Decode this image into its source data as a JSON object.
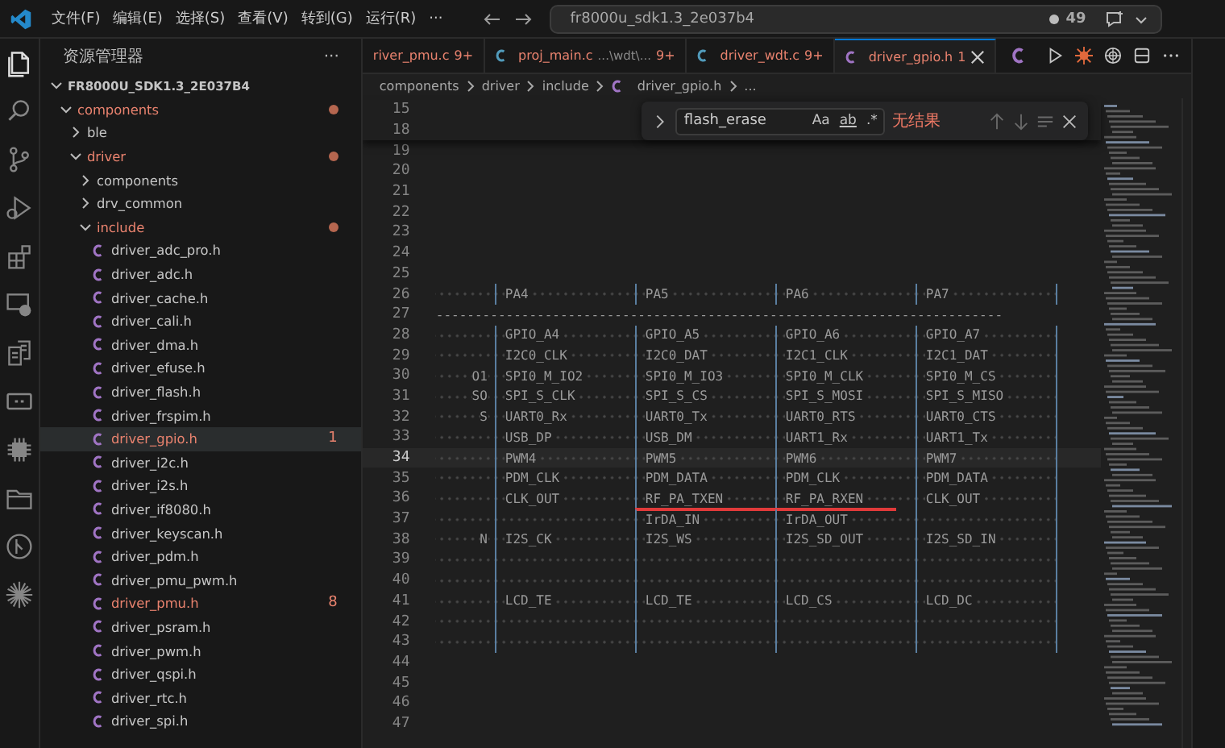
{
  "title_bar": {
    "menu": [
      "文件(F)",
      "编辑(E)",
      "选择(S)",
      "查看(V)",
      "转到(G)",
      "运行(R)",
      "···"
    ],
    "search": {
      "value": "fr8000u_sdk1.3_2e037b4"
    },
    "count": "49"
  },
  "activity_bar": [
    {
      "kind": "files",
      "selected": true
    },
    {
      "kind": "search",
      "selected": false
    },
    {
      "kind": "source-control",
      "selected": false
    },
    {
      "kind": "run",
      "selected": false
    },
    {
      "kind": "extensions",
      "selected": false
    },
    {
      "kind": "remote",
      "selected": false
    },
    {
      "kind": "clipboard",
      "selected": false
    },
    {
      "kind": "panel",
      "selected": false
    },
    {
      "kind": "chip",
      "selected": false
    },
    {
      "kind": "folder",
      "selected": false
    },
    {
      "kind": "branch",
      "selected": false
    },
    {
      "kind": "sparkle",
      "selected": false
    }
  ],
  "sidebar": {
    "title": "资源管理器",
    "more": "···",
    "tree": [
      {
        "label": "FR8000U_SDK1.3_2E037B4",
        "kind": "root",
        "expanded": true,
        "problems": false,
        "selected": false,
        "children": [
          {
            "label": "components",
            "kind": "folder",
            "expanded": true,
            "problems": true,
            "selected": false,
            "children": [
              {
                "label": "ble",
                "kind": "folder",
                "expanded": false,
                "problems": false,
                "selected": false
              },
              {
                "label": "driver",
                "kind": "folder",
                "expanded": true,
                "problems": true,
                "selected": false,
                "children": [
                  {
                    "label": "components",
                    "kind": "folder",
                    "expanded": false,
                    "problems": false,
                    "selected": false
                  },
                  {
                    "label": "drv_common",
                    "kind": "folder",
                    "expanded": false,
                    "problems": false,
                    "selected": false
                  },
                  {
                    "label": "include",
                    "kind": "folder",
                    "expanded": true,
                    "problems": true,
                    "selected": false,
                    "children": [
                      {
                        "label": "driver_adc_pro.h",
                        "kind": "file",
                        "problems": false,
                        "selected": false
                      },
                      {
                        "label": "driver_adc.h",
                        "kind": "file",
                        "problems": false,
                        "selected": false
                      },
                      {
                        "label": "driver_cache.h",
                        "kind": "file",
                        "problems": false,
                        "selected": false
                      },
                      {
                        "label": "driver_cali.h",
                        "kind": "file",
                        "problems": false,
                        "selected": false
                      },
                      {
                        "label": "driver_dma.h",
                        "kind": "file",
                        "problems": false,
                        "selected": false
                      },
                      {
                        "label": "driver_efuse.h",
                        "kind": "file",
                        "problems": false,
                        "selected": false
                      },
                      {
                        "label": "driver_flash.h",
                        "kind": "file",
                        "problems": false,
                        "selected": false
                      },
                      {
                        "label": "driver_frspim.h",
                        "kind": "file",
                        "problems": false,
                        "selected": false
                      },
                      {
                        "label": "driver_gpio.h",
                        "kind": "file",
                        "problems": true,
                        "badge": "1",
                        "selected": true
                      },
                      {
                        "label": "driver_i2c.h",
                        "kind": "file",
                        "problems": false,
                        "selected": false
                      },
                      {
                        "label": "driver_i2s.h",
                        "kind": "file",
                        "problems": false,
                        "selected": false
                      },
                      {
                        "label": "driver_if8080.h",
                        "kind": "file",
                        "problems": false,
                        "selected": false
                      },
                      {
                        "label": "driver_keyscan.h",
                        "kind": "file",
                        "problems": false,
                        "selected": false
                      },
                      {
                        "label": "driver_pdm.h",
                        "kind": "file",
                        "problems": false,
                        "selected": false
                      },
                      {
                        "label": "driver_pmu_pwm.h",
                        "kind": "file",
                        "problems": false,
                        "selected": false
                      },
                      {
                        "label": "driver_pmu.h",
                        "kind": "file",
                        "problems": true,
                        "badge": "8",
                        "selected": false
                      },
                      {
                        "label": "driver_psram.h",
                        "kind": "file",
                        "problems": false,
                        "selected": false
                      },
                      {
                        "label": "driver_pwm.h",
                        "kind": "file",
                        "problems": false,
                        "selected": false
                      },
                      {
                        "label": "driver_qspi.h",
                        "kind": "file",
                        "problems": false,
                        "selected": false
                      },
                      {
                        "label": "driver_rtc.h",
                        "kind": "file",
                        "problems": false,
                        "selected": false
                      },
                      {
                        "label": "driver_spi.h",
                        "kind": "file",
                        "problems": false,
                        "selected": false
                      }
                    ]
                  }
                ]
              }
            ]
          }
        ]
      }
    ]
  },
  "tabs": [
    {
      "label": "river_pmu.c",
      "badge": "9+",
      "problems": true,
      "selected": false
    },
    {
      "label": "proj_main.c",
      "color": "#519aba",
      "description": "...\\wdt\\...",
      "badge": "9+",
      "problems": true,
      "selected": false
    },
    {
      "label": "driver_wdt.c",
      "color": "#519aba",
      "badge": "9+",
      "problems": true,
      "selected": false
    },
    {
      "label": "driver_gpio.h",
      "color": "#a074c4",
      "badge": "1",
      "problems": true,
      "selected": true
    }
  ],
  "breadcrumb": [
    "components",
    "driver",
    "include",
    "driver_gpio.h",
    "..."
  ],
  "find": {
    "query": "flash_erase",
    "options": [
      "Aa",
      "ab",
      ".*"
    ],
    "result": "无结果"
  },
  "sticky_lines": [
    "15",
    "18"
  ],
  "lines": [
    {
      "number": "19",
      "kind": "blank",
      "current": false
    },
    {
      "number": "20",
      "kind": "blank",
      "current": false
    },
    {
      "number": "21",
      "kind": "blank",
      "current": false
    },
    {
      "number": "22",
      "kind": "blank",
      "current": false
    },
    {
      "number": "23",
      "kind": "blank",
      "current": false
    },
    {
      "number": "24",
      "kind": "blank",
      "current": false
    },
    {
      "number": "25",
      "kind": "blank",
      "current": false
    },
    {
      "number": "26",
      "kind": "row",
      "current": false,
      "cells": [
        "PA4",
        "PA5",
        "PA6",
        "PA7"
      ]
    },
    {
      "number": "27",
      "kind": "rule",
      "current": false,
      "text": "-------------------------------------------------------------------------"
    },
    {
      "number": "28",
      "kind": "row",
      "current": false,
      "cells": [
        "GPIO_A4",
        "GPIO_A5",
        "GPIO_A6",
        "GPIO_A7"
      ]
    },
    {
      "number": "29",
      "kind": "row",
      "current": false,
      "cells": [
        "I2C0_CLK",
        "I2C0_DAT",
        "I2C1_CLK",
        "I2C1_DAT"
      ]
    },
    {
      "number": "30",
      "kind": "row",
      "current": false,
      "lead": "O1",
      "cells": [
        "SPI0_M_IO2",
        "SPI0_M_IO3",
        "SPI0_M_CLK",
        "SPI0_M_CS"
      ]
    },
    {
      "number": "31",
      "kind": "row",
      "current": false,
      "lead": "SO",
      "cells": [
        "SPI_S_CLK",
        "SPI_S_CS",
        "SPI_S_MOSI",
        "SPI_S_MISO"
      ]
    },
    {
      "number": "32",
      "kind": "row",
      "current": false,
      "lead": "S",
      "cells": [
        "UART0_Rx",
        "UART0_Tx",
        "UART0_RTS",
        "UART0_CTS"
      ]
    },
    {
      "number": "33",
      "kind": "row",
      "current": false,
      "cells": [
        "USB_DP",
        "USB_DM",
        "UART1_Rx",
        "UART1_Tx"
      ]
    },
    {
      "number": "34",
      "kind": "row",
      "current": true,
      "cells": [
        "PWM4",
        "PWM5",
        "PWM6",
        "PWM7"
      ]
    },
    {
      "number": "35",
      "kind": "row",
      "current": false,
      "cells": [
        "PDM_CLK",
        "PDM_DATA",
        "PDM_CLK",
        "PDM_DATA"
      ]
    },
    {
      "number": "36",
      "kind": "row",
      "current": false,
      "underline": true,
      "cells": [
        "CLK_OUT",
        "RF_PA_TXEN",
        "RF_PA_RXEN",
        "CLK_OUT"
      ]
    },
    {
      "number": "37",
      "kind": "row",
      "current": false,
      "cells": [
        null,
        "IrDA_IN",
        "IrDA_OUT",
        null
      ]
    },
    {
      "number": "38",
      "kind": "row",
      "current": false,
      "lead": "N",
      "cells": [
        "I2S_CK",
        "I2S_WS",
        "I2S_SD_OUT",
        "I2S_SD_IN"
      ]
    },
    {
      "number": "39",
      "kind": "row",
      "current": false,
      "cells": [
        null,
        null,
        null,
        null
      ]
    },
    {
      "number": "40",
      "kind": "row",
      "current": false,
      "cells": [
        null,
        null,
        null,
        null
      ]
    },
    {
      "number": "41",
      "kind": "row",
      "current": false,
      "cells": [
        "LCD_TE",
        "LCD_TE",
        "LCD_CS",
        "LCD_DC"
      ]
    },
    {
      "number": "42",
      "kind": "row",
      "current": false,
      "cells": [
        null,
        null,
        null,
        null
      ]
    },
    {
      "number": "43",
      "kind": "row",
      "current": false,
      "cells": [
        null,
        null,
        null,
        null
      ]
    },
    {
      "number": "44",
      "kind": "blank",
      "current": false
    },
    {
      "number": "45",
      "kind": "blank",
      "current": false
    },
    {
      "number": "46",
      "kind": "blank",
      "current": false
    },
    {
      "number": "47",
      "kind": "blank",
      "current": false
    }
  ]
}
